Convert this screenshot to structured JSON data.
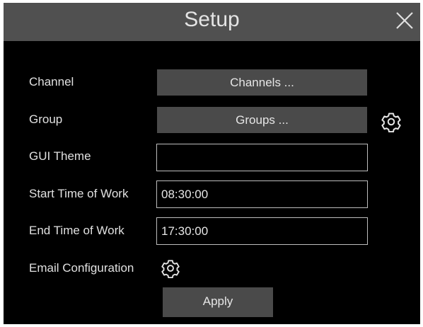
{
  "dialog": {
    "title": "Setup",
    "close_icon": "close-icon"
  },
  "form": {
    "channel": {
      "label": "Channel",
      "button_label": "Channels ..."
    },
    "group": {
      "label": "Group",
      "button_label": "Groups ...",
      "settings_icon": "gear-icon"
    },
    "gui_theme": {
      "label": "GUI Theme",
      "value": ""
    },
    "start_time": {
      "label": "Start Time of Work",
      "value": "08:30:00"
    },
    "end_time": {
      "label": "End Time of Work",
      "value": "17:30:00"
    },
    "email_config": {
      "label": "Email Configuration",
      "settings_icon": "gear-icon"
    }
  },
  "actions": {
    "apply_label": "Apply"
  },
  "colors": {
    "dialog_background": "#000000",
    "titlebar_background": "#505050",
    "button_background": "#4a4a4a",
    "text": "#e0e0e0",
    "field_border": "#bdbdbd"
  }
}
